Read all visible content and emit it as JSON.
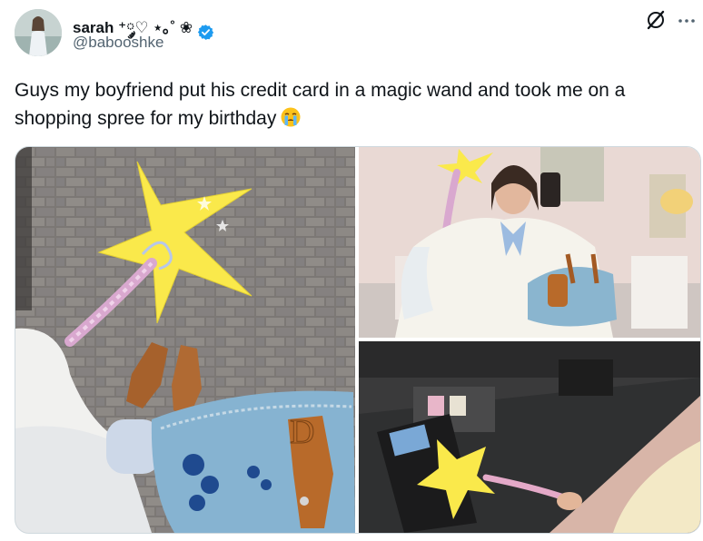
{
  "user": {
    "display_name": "sarah ⁺༘♡ ⋆｡˚ ❀",
    "handle": "@babooshke",
    "verified": true,
    "avatar_icon": "avatar-photo"
  },
  "tweet": {
    "text": "Guys my boyfriend put his credit card in a magic wand and took me on a shopping spree for my birthday",
    "emoji_icon": "crying-face-emoji"
  },
  "media": [
    {
      "name": "wand-on-pavement-photo"
    },
    {
      "name": "mirror-selfie-photo"
    },
    {
      "name": "wand-at-card-terminal-photo"
    }
  ],
  "icons": {
    "grok": "grok-icon",
    "more": "more-options-icon"
  },
  "colors": {
    "verified": "#1d9bf0",
    "star": "#fae94b",
    "text": "#0f1419",
    "secondary_text": "#536471"
  }
}
